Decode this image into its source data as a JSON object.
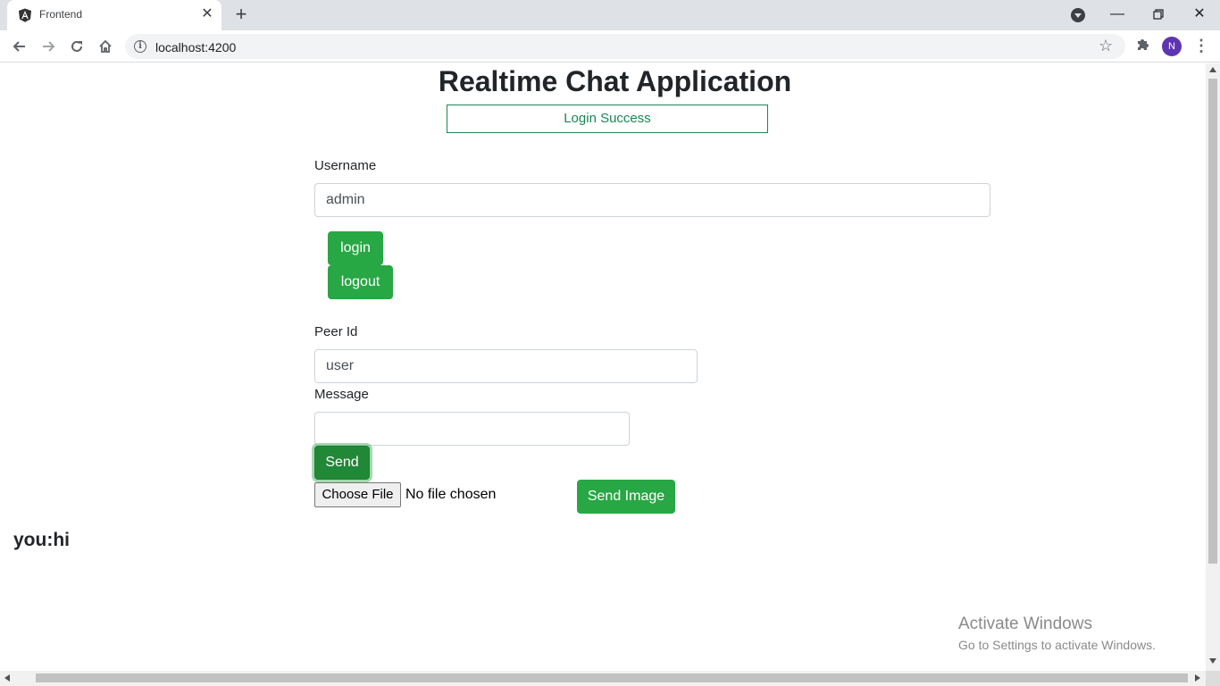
{
  "browser": {
    "tab_title": "Frontend",
    "url": "localhost:4200",
    "profile_initial": "N",
    "icons": {
      "favicon": "angular-logo-icon",
      "close_tab": "close-icon",
      "new_tab": "plus-icon",
      "tab_search": "tab-search-icon",
      "back": "arrow-left-icon",
      "forward": "arrow-right-icon",
      "reload": "reload-icon",
      "home": "home-icon",
      "site_info": "info-icon",
      "bookmark": "star-icon",
      "extensions": "puzzle-icon",
      "menu": "kebab-menu-icon"
    }
  },
  "page": {
    "title": "Realtime Chat Application",
    "status": "Login Success",
    "username": {
      "label": "Username",
      "value": "admin"
    },
    "buttons": {
      "login": "login",
      "logout": "logout",
      "send": "Send",
      "send_image": "Send Image"
    },
    "peer": {
      "label": "Peer Id",
      "value": "user"
    },
    "message": {
      "label": "Message",
      "value": ""
    },
    "file": {
      "button": "Choose File",
      "status": "No file chosen"
    },
    "chat": [
      {
        "text": "you:hi"
      }
    ]
  },
  "os_watermark": {
    "title": "Activate Windows",
    "subtitle": "Go to Settings to activate Windows."
  },
  "colors": {
    "success": "#28a745",
    "status_green": "#198754",
    "chrome_bg": "#dee1e6",
    "avatar": "#5e35b1"
  }
}
